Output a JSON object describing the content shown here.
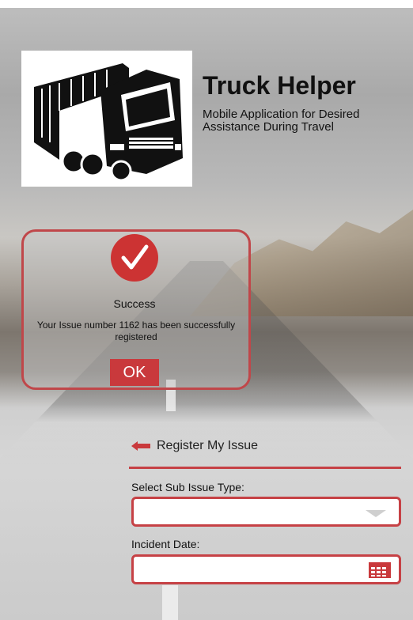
{
  "app": {
    "title": "Truck Helper",
    "subtitle": "Mobile Application for Desired Assistance During Travel",
    "logo_icon": "truck-icon"
  },
  "dialog": {
    "icon": "checkmark-icon",
    "title": "Success",
    "message": "Your Issue number 1162 has been successfully registered",
    "ok_label": "OK"
  },
  "form": {
    "back_label": "Register My Issue",
    "back_icon": "left-arrow-icon",
    "sub_issue_label": "Select Sub Issue Type:",
    "sub_issue_value": "",
    "incident_date_label": "Incident Date:",
    "incident_date_value": ""
  },
  "colors": {
    "accent": "#c64145",
    "accent_button": "#c9393c"
  }
}
